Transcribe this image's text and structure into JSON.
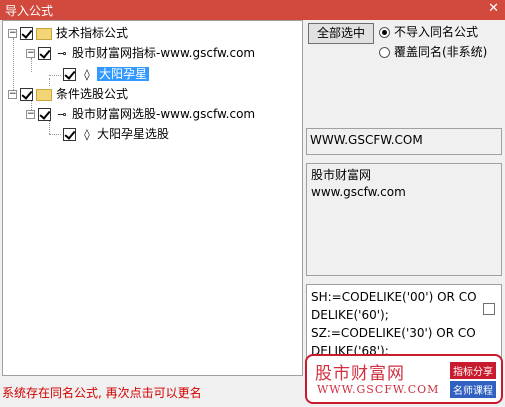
{
  "window": {
    "title": "导入公式",
    "close_glyph": "✕"
  },
  "tree": {
    "nodes": [
      {
        "label": "技术指标公式"
      },
      {
        "label": "股市财富网指标-www.gscfw.com"
      },
      {
        "label": "大阳孕星"
      },
      {
        "label": "条件选股公式"
      },
      {
        "label": "股市财富网选股-www.gscfw.com"
      },
      {
        "label": "大阳孕星选股"
      }
    ]
  },
  "buttons": {
    "select_all": "全部选中"
  },
  "options": {
    "no_import": "不导入同名公式",
    "overwrite": "覆盖同名(非系统)"
  },
  "info": {
    "url": "WWW.GSCFW.COM",
    "desc_line1": "股市财富网",
    "desc_line2": "www.gscfw.com",
    "code": "SH:=CODELIKE('00') OR CODELIKE('60');\nSZ:=CODELIKE('30') OR CODELIKE('68');"
  },
  "status": "系统存在同名公式, 再次点击可以更名",
  "watermark": {
    "name": "股市财富网",
    "url": "WWW.GSCFW.COM",
    "tag1": "指标分享",
    "tag2": "名师课程"
  }
}
